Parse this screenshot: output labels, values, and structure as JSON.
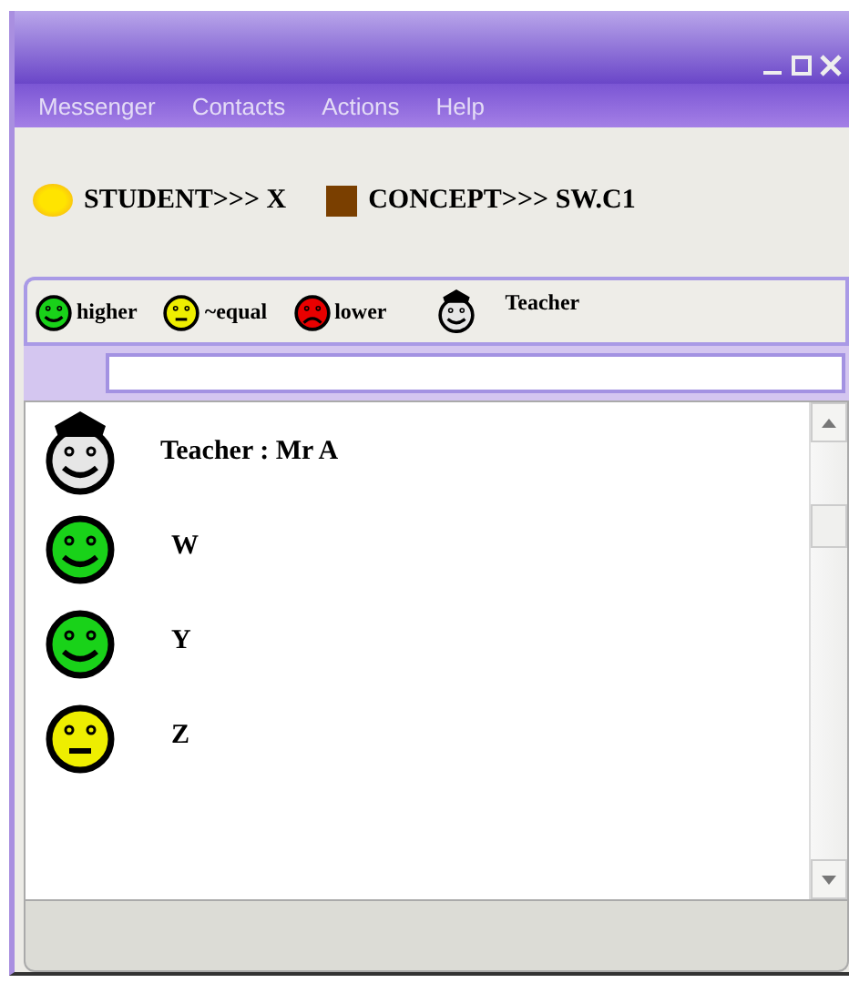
{
  "menu": [
    "Messenger",
    "Contacts",
    "Actions",
    "Help"
  ],
  "info": [
    {
      "kind": "student",
      "label": "STUDENT>>> X"
    },
    {
      "kind": "concept",
      "label": "CONCEPT>>> SW.C1"
    }
  ],
  "legend": [
    {
      "kind": "higher",
      "label": "higher"
    },
    {
      "kind": "equal",
      "label": "~equal"
    },
    {
      "kind": "lower",
      "label": "lower"
    },
    {
      "kind": "teacher",
      "label": "Teacher"
    }
  ],
  "contacts": [
    {
      "kind": "teacher",
      "name": "Teacher : Mr A"
    },
    {
      "kind": "higher",
      "name": "W"
    },
    {
      "kind": "higher",
      "name": "Y"
    },
    {
      "kind": "equal",
      "name": "Z"
    }
  ]
}
